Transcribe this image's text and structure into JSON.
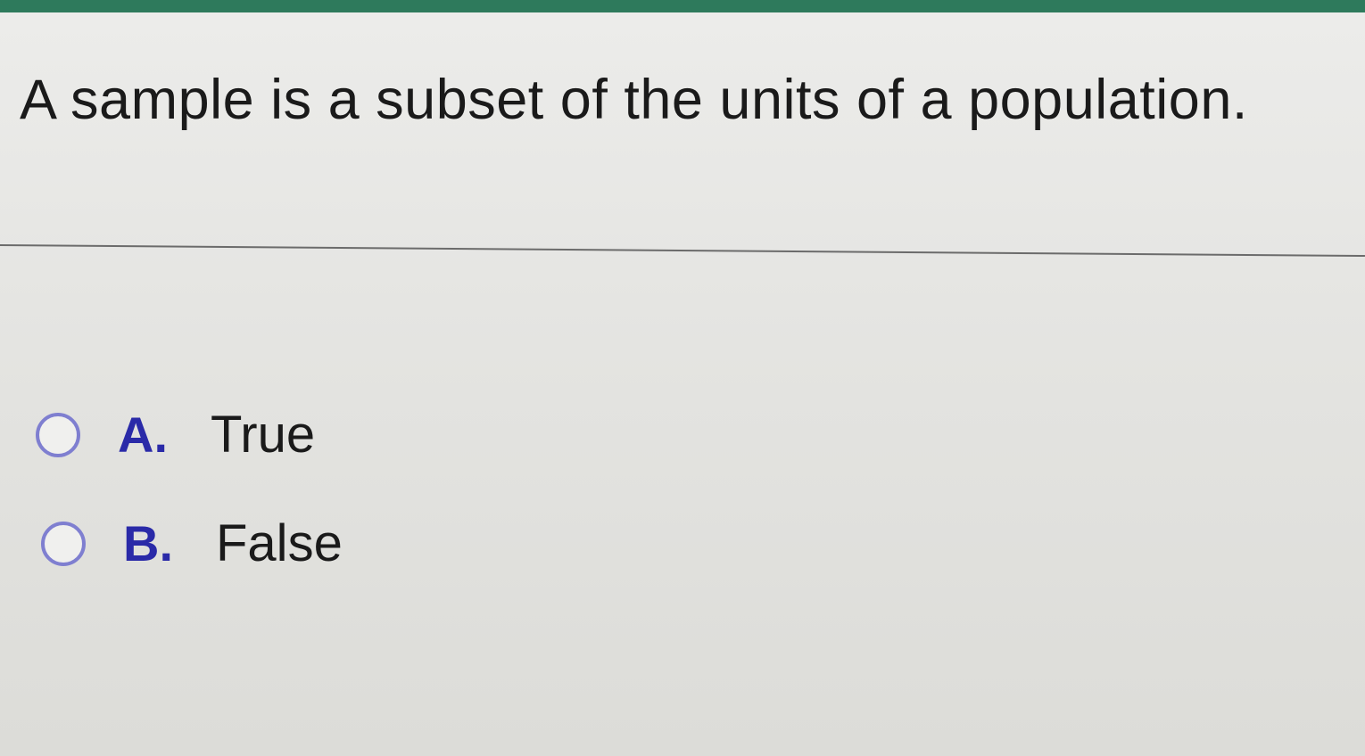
{
  "question": {
    "text": "A sample is a subset of the units of a population."
  },
  "choices": [
    {
      "letter": "A.",
      "label": "True",
      "selected": false
    },
    {
      "letter": "B.",
      "label": "False",
      "selected": false
    }
  ],
  "colors": {
    "top_bar": "#2e7a5c",
    "choice_letter": "#2a2aa8",
    "radio_border": "#7f7fd0"
  }
}
